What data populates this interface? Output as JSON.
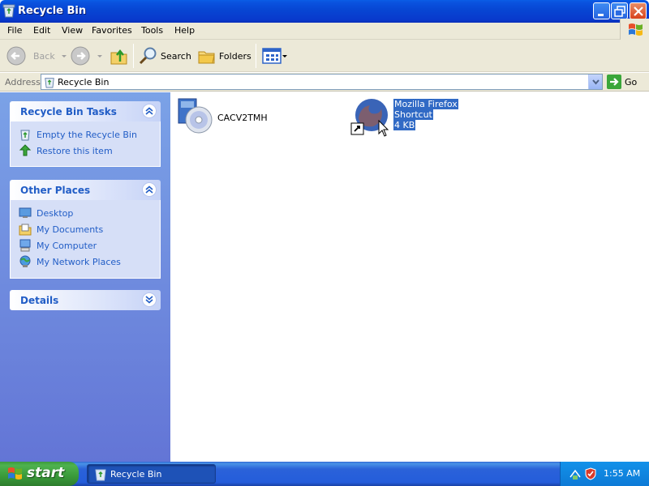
{
  "window": {
    "title": "Recycle Bin"
  },
  "menubar": {
    "items": [
      "File",
      "Edit",
      "View",
      "Favorites",
      "Tools",
      "Help"
    ]
  },
  "toolbar": {
    "back": "Back",
    "search": "Search",
    "folders": "Folders"
  },
  "address": {
    "label": "Address",
    "value": "Recycle Bin",
    "go": "Go"
  },
  "taskpane": {
    "tasks": {
      "title": "Recycle Bin Tasks",
      "items": [
        "Empty the Recycle Bin",
        "Restore this item"
      ]
    },
    "places": {
      "title": "Other Places",
      "items": [
        "Desktop",
        "My Documents",
        "My Computer",
        "My Network Places"
      ]
    },
    "details": {
      "title": "Details"
    }
  },
  "files": [
    {
      "name": "CACV2TMH"
    },
    {
      "name_line1": "Mozilla Firefox",
      "name_line2": "Shortcut",
      "size": "4 KB"
    }
  ],
  "taskbar": {
    "start": "start",
    "task": "Recycle Bin",
    "clock": "1:55 AM"
  },
  "colors": {
    "titlebar": "#0747d4",
    "panel_link": "#215dc6",
    "selection": "#316ac5",
    "start_green": "#3c9a3c"
  }
}
